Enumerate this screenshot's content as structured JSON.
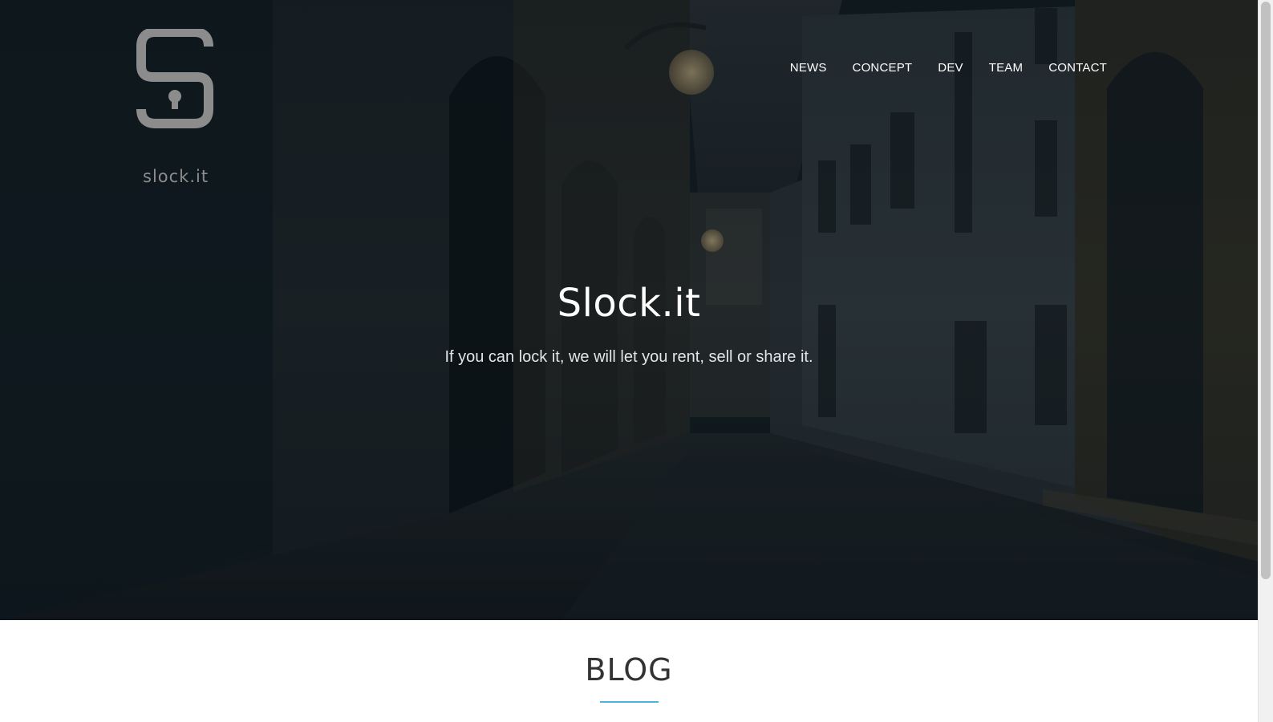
{
  "brand": {
    "logo_text": "slock.it",
    "logo_icon": "lock-s-icon"
  },
  "nav": {
    "items": [
      {
        "label": "NEWS"
      },
      {
        "label": "CONCEPT"
      },
      {
        "label": "DEV"
      },
      {
        "label": "TEAM"
      },
      {
        "label": "CONTACT"
      }
    ]
  },
  "hero": {
    "title": "Slock.it",
    "subtitle": "If you can lock it, we will let you rent, sell or share it.",
    "background": "dark-street-photo"
  },
  "blog": {
    "heading": "BLOG",
    "accent_color": "#4ab3e6"
  }
}
